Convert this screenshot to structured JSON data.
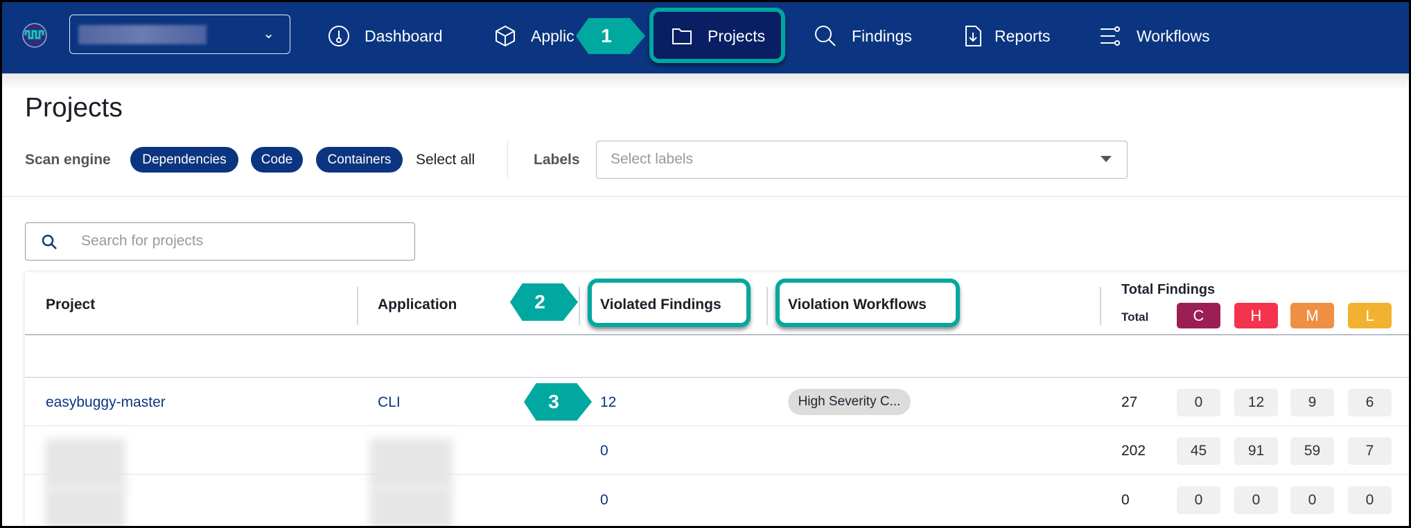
{
  "nav": {
    "items": [
      {
        "label": "Dashboard",
        "icon": "dashboard-gauge-icon"
      },
      {
        "label": "Applic",
        "icon": "cube-icon"
      },
      {
        "label": "Projects",
        "icon": "folder-icon"
      },
      {
        "label": "Findings",
        "icon": "search-icon"
      },
      {
        "label": "Reports",
        "icon": "report-download-icon"
      },
      {
        "label": "Workflows",
        "icon": "workflow-icon"
      }
    ],
    "org_selector_chevron": "⌄"
  },
  "callouts": [
    "1",
    "2",
    "3"
  ],
  "page": {
    "title": "Projects",
    "scan_engine_label": "Scan engine",
    "scan_engines": [
      "Dependencies",
      "Code",
      "Containers"
    ],
    "select_all": "Select all",
    "labels_label": "Labels",
    "labels_placeholder": "Select labels",
    "search_placeholder": "Search for projects"
  },
  "table": {
    "headers": {
      "project": "Project",
      "application": "Application",
      "violated": "Violated Findings",
      "workflows": "Violation Workflows",
      "total_findings": "Total Findings",
      "total": "Total"
    },
    "severities": [
      {
        "label": "C",
        "color": "#9b1f55"
      },
      {
        "label": "H",
        "color": "#f4344f"
      },
      {
        "label": "M",
        "color": "#ee9044"
      },
      {
        "label": "L",
        "color": "#f2b12f"
      }
    ],
    "rows": [
      {
        "project": "easybuggy-master",
        "application": "CLI",
        "violated": "12",
        "workflow": "High Severity C...",
        "total": "27",
        "c": "0",
        "h": "12",
        "m": "9",
        "l": "6"
      },
      {
        "project": "",
        "application": "",
        "violated": "0",
        "workflow": "",
        "total": "202",
        "c": "45",
        "h": "91",
        "m": "59",
        "l": "7"
      },
      {
        "project": "",
        "application": "",
        "violated": "0",
        "workflow": "",
        "total": "0",
        "c": "0",
        "h": "0",
        "m": "0",
        "l": "0"
      }
    ]
  },
  "colors": {
    "nav_bg": "#0b3580",
    "accent": "#00a8a0"
  }
}
